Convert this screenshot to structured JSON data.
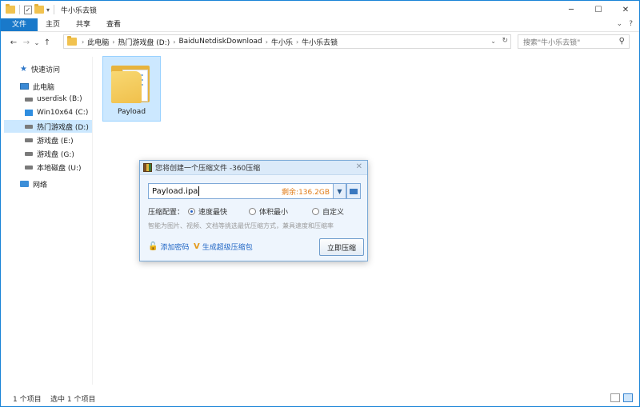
{
  "window": {
    "title": "牛小乐去锁",
    "minimize": "─",
    "maximize": "☐",
    "close": "✕",
    "qat_arrow": "▾"
  },
  "ribbon": {
    "tabs": [
      "文件",
      "主页",
      "共享",
      "查看"
    ],
    "collapse": "⌄",
    "help": "?"
  },
  "nav": {
    "back": "←",
    "forward": "→",
    "recent": "⌄",
    "up": "↑",
    "breadcrumb": [
      "此电脑",
      "热门游戏盘 (D:)",
      "BaiduNetdiskDownload",
      "牛小乐",
      "牛小乐去锁"
    ],
    "crumb_sep": "›",
    "dropdown": "⌄",
    "refresh": "↻",
    "search_placeholder": "搜索\"牛小乐去锁\"",
    "search_glyph": "⚲"
  },
  "sidebar": {
    "items": [
      {
        "label": "快速访问",
        "icon": "star-icon"
      },
      {
        "label": "此电脑",
        "icon": "pc-icon"
      },
      {
        "label": "userdisk (B:)",
        "icon": "drive-icon"
      },
      {
        "label": "Win10x64 (C:)",
        "icon": "windows-drive-icon"
      },
      {
        "label": "热门游戏盘 (D:)",
        "icon": "drive-icon",
        "selected": true
      },
      {
        "label": "游戏盘 (E:)",
        "icon": "drive-icon"
      },
      {
        "label": "游戏盘 (G:)",
        "icon": "drive-icon"
      },
      {
        "label": "本地磁盘 (U:)",
        "icon": "drive-icon"
      },
      {
        "label": "网络",
        "icon": "network-icon"
      }
    ],
    "star_glyph": "★"
  },
  "content": {
    "files": [
      {
        "name": "Payload"
      }
    ]
  },
  "dialog": {
    "title": "您将创建一个压缩文件 -360压缩",
    "close": "✕",
    "filename": "Payload.ipa",
    "remaining": "剩余:136.2GB",
    "drop_glyph": "▼",
    "config_label": "压缩配置：",
    "options": [
      "速度最快",
      "体积最小",
      "自定义"
    ],
    "selected_option": 0,
    "hint": "智能为图片、视频、文档等挑选最优压缩方式，兼具速度和压缩率",
    "add_password": "添加密码",
    "lock_glyph": "🔓",
    "super_pack": "生成超级压缩包",
    "v_glyph": "V",
    "ok": "立即压缩"
  },
  "status": {
    "count": "1 个项目",
    "selected": "选中 1 个项目"
  }
}
